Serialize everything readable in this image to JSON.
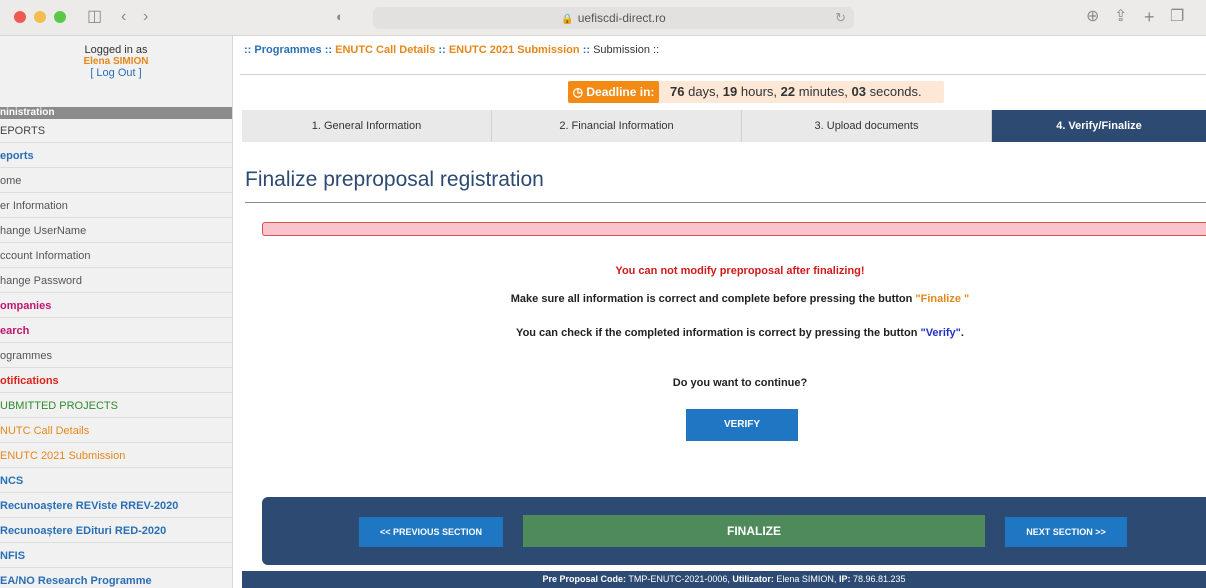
{
  "browser": {
    "url": "uefiscdi-direct.ro",
    "traffic_colors": [
      "#ee5a52",
      "#f5bd4f",
      "#5cc84a"
    ]
  },
  "sidebar": {
    "logged_in_label": "Logged in as",
    "user_name": "Elena SIMION",
    "logout_label": "[ Log Out ]",
    "section_header": "ninistration",
    "items": [
      {
        "label": "EPORTS",
        "color": "#444444",
        "bold": false
      },
      {
        "label": "eports",
        "color": "#2a6fb5",
        "bold": true
      },
      {
        "label": "ome",
        "color": "#555555",
        "bold": false
      },
      {
        "label": "er Information",
        "color": "#555555",
        "bold": false
      },
      {
        "label": "hange UserName",
        "color": "#555555",
        "bold": false
      },
      {
        "label": "ccount Information",
        "color": "#555555",
        "bold": false
      },
      {
        "label": "hange Password",
        "color": "#555555",
        "bold": false
      },
      {
        "label": "ompanies",
        "color": "#c0166f",
        "bold": true
      },
      {
        "label": "earch",
        "color": "#c0166f",
        "bold": true
      },
      {
        "label": "ogrammes",
        "color": "#555555",
        "bold": false
      },
      {
        "label": "otifications",
        "color": "#d9231b",
        "bold": true
      },
      {
        "label": "UBMITTED PROJECTS",
        "color": "#2e8b2e",
        "bold": false
      },
      {
        "label": "NUTC Call Details",
        "color": "#e5871a",
        "bold": false
      },
      {
        "label": "ENUTC 2021 Submission",
        "color": "#e5871a",
        "bold": false
      },
      {
        "label": "NCS",
        "color": "#2a6fb5",
        "bold": true
      },
      {
        "label": "Recunoaștere REViste RREV-2020",
        "color": "#2a6fb5",
        "bold": true
      },
      {
        "label": "Recunoaștere EDituri RED-2020",
        "color": "#2a6fb5",
        "bold": true
      },
      {
        "label": "NFIS",
        "color": "#2a6fb5",
        "bold": true
      },
      {
        "label": "EA/NO Research Programme",
        "color": "#2a6fb5",
        "bold": true
      }
    ]
  },
  "breadcrumb": {
    "sep1": "::",
    "programmes": "Programmes",
    "sep2": "::",
    "call_details": "ENUTC Call Details",
    "sep3": "::",
    "submission_2021": "ENUTC 2021 Submission",
    "sep4": "::",
    "current": "Submission",
    "sep5": "::"
  },
  "deadline": {
    "label": "Deadline in:",
    "days": "76",
    "days_unit": "days,",
    "hours": "19",
    "hours_unit": "hours,",
    "minutes": "22",
    "minutes_unit": "minutes,",
    "seconds": "03",
    "seconds_unit": "seconds."
  },
  "tabs": [
    {
      "label": "1. General Information",
      "active": false
    },
    {
      "label": "2. Financial Information",
      "active": false
    },
    {
      "label": "3. Upload documents",
      "active": false
    },
    {
      "label": "4. Verify/Finalize",
      "active": true
    }
  ],
  "main": {
    "title": "Finalize preproposal registration",
    "warning": "You can not modify preproposal after finalizing!",
    "instruction_pre": "Make sure all information is correct and complete before pressing the button",
    "instruction_finalize": "\"Finalize \"",
    "check_pre": "You can check if the completed information is correct by pressing the button",
    "check_verify": "\"Verify\"",
    "check_post": ".",
    "question": "Do you want to continue?",
    "verify_button": "VERIFY"
  },
  "actions": {
    "previous": "<< PREVIOUS SECTION",
    "finalize": "FINALIZE",
    "next": "NEXT SECTION >>"
  },
  "footer": {
    "code_label": "Pre Proposal Code:",
    "code_value": "TMP-ENUTC-2021-0006,",
    "user_label": "Utilizator:",
    "user_value": "Elena SIMION,",
    "ip_label": "IP:",
    "ip_value": "78.96.81.235"
  }
}
